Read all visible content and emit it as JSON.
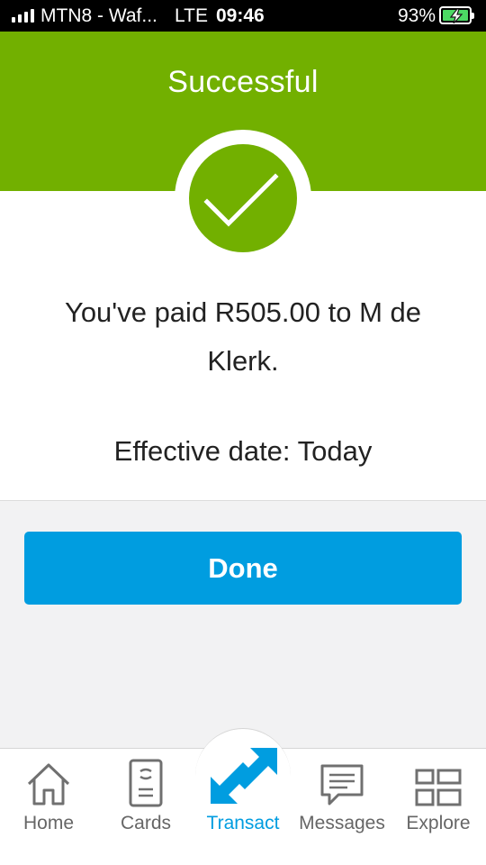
{
  "status_bar": {
    "carrier": "MTN8 - Waf...",
    "network": "LTE",
    "time": "09:46",
    "battery_percent": "93%",
    "battery_level": 0.93,
    "battery_charging": true
  },
  "header": {
    "title": "Successful",
    "color": "#72b000"
  },
  "result": {
    "message": "You've paid R505.00 to M de Klerk.",
    "effective_date": "Effective date: Today",
    "icon": "checkmark-icon"
  },
  "actions": {
    "done_label": "Done",
    "accent": "#009de0"
  },
  "tab_bar": {
    "active": "Transact",
    "items": [
      {
        "label": "Home",
        "icon": "home-icon"
      },
      {
        "label": "Cards",
        "icon": "card-icon"
      },
      {
        "label": "Transact",
        "icon": "transfer-arrows-icon"
      },
      {
        "label": "Messages",
        "icon": "message-icon"
      },
      {
        "label": "Explore",
        "icon": "grid-icon"
      }
    ]
  }
}
